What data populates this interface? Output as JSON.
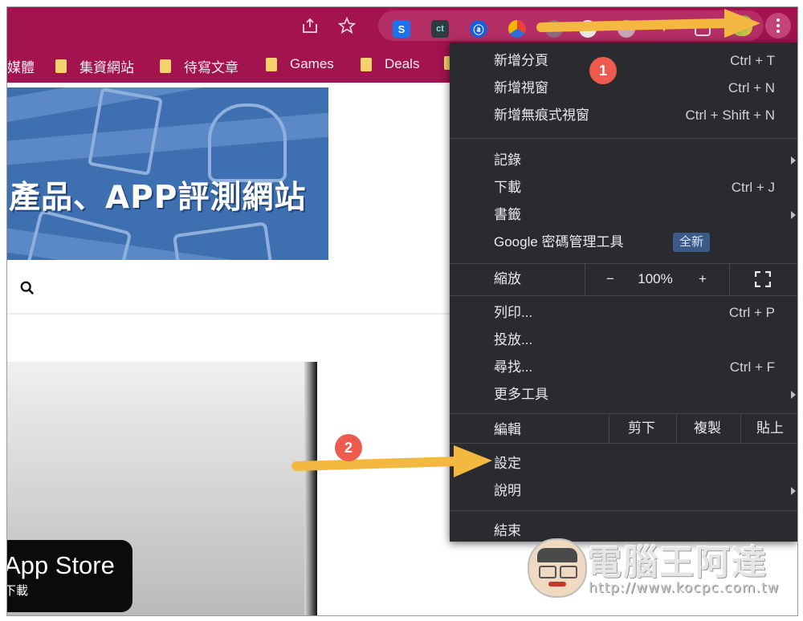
{
  "toolbar": {
    "icons": [
      "share-icon",
      "star-icon"
    ],
    "extensions": [
      {
        "name": "s-extension-icon",
        "label": "S",
        "bg": "#1a73e8"
      },
      {
        "name": "ct-extension-icon",
        "label": "ct",
        "bg": "#2f3b3f"
      },
      {
        "name": "at-extension-icon",
        "label": "ⓐ",
        "bg": "#1b5fd6"
      }
    ]
  },
  "bookmarks": [
    {
      "label": "媒體",
      "folder": false
    },
    {
      "label": "集資網站",
      "folder": true
    },
    {
      "label": "待寫文章",
      "folder": true
    },
    {
      "label": "Games",
      "folder": true
    },
    {
      "label": "Deals",
      "folder": true
    }
  ],
  "page": {
    "banner_text": "產品、APP評測網站",
    "appstore_line1": "App Store",
    "appstore_line2": "下載"
  },
  "menu": {
    "new_tab": {
      "label": "新增分頁",
      "shortcut": "Ctrl + T"
    },
    "new_window": {
      "label": "新增視窗",
      "shortcut": "Ctrl + N"
    },
    "new_incognito": {
      "label": "新增無痕式視窗",
      "shortcut": "Ctrl + Shift + N"
    },
    "history": {
      "label": "記錄"
    },
    "downloads": {
      "label": "下載",
      "shortcut": "Ctrl + J"
    },
    "bookmarks": {
      "label": "書籤"
    },
    "password_manager": {
      "label": "Google 密碼管理工具",
      "badge": "全新"
    },
    "zoom": {
      "label": "縮放",
      "minus": "−",
      "value": "100%",
      "plus": "+"
    },
    "print": {
      "label": "列印...",
      "shortcut": "Ctrl + P"
    },
    "cast": {
      "label": "投放..."
    },
    "find": {
      "label": "尋找...",
      "shortcut": "Ctrl + F"
    },
    "more_tools": {
      "label": "更多工具"
    },
    "edit": {
      "label": "編輯",
      "cut": "剪下",
      "copy": "複製",
      "paste": "貼上"
    },
    "settings": {
      "label": "設定"
    },
    "help": {
      "label": "說明"
    },
    "exit": {
      "label": "結束"
    }
  },
  "annotations": {
    "badge1": "1",
    "badge2": "2",
    "arrow_color": "#f4b740",
    "badge_color": "#ee5b4e"
  },
  "watermark": {
    "title": "電腦王阿達",
    "url": "http://www.kocpc.com.tw"
  }
}
